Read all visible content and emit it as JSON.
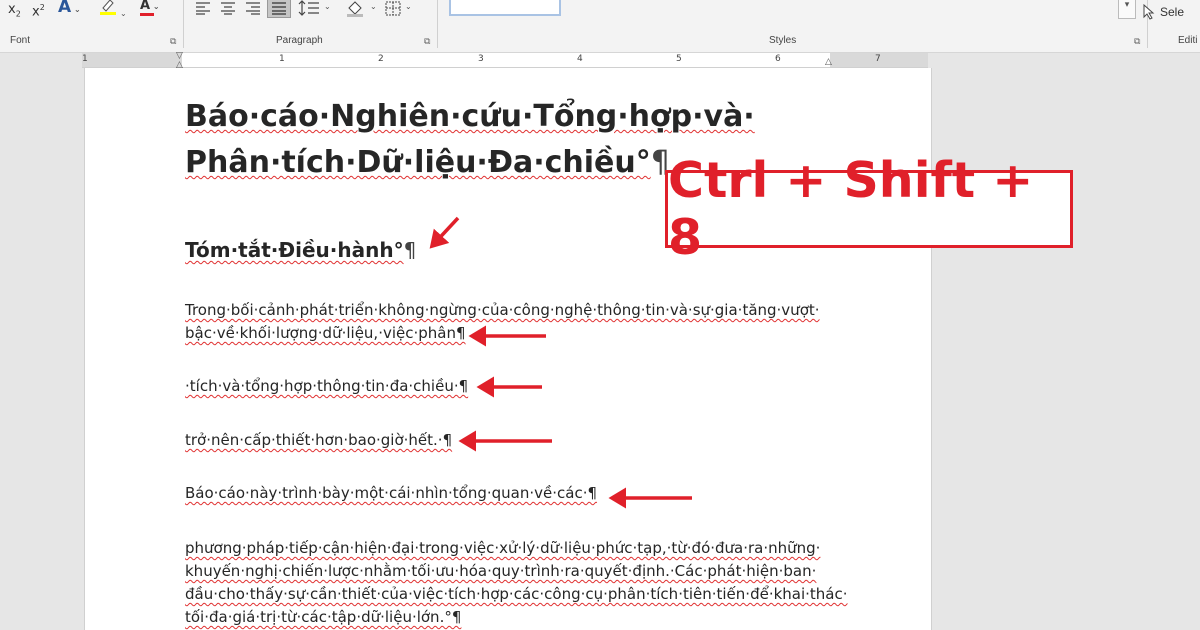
{
  "ribbon": {
    "font_group_label": "Font",
    "paragraph_group_label": "Paragraph",
    "styles_group_label": "Styles",
    "editing_group_label": "Editi",
    "select_label": "Sele",
    "subscript_label": "x",
    "subscript_sub": "2",
    "superscript_label": "x",
    "superscript_sup": "2",
    "text_effects_label": "A",
    "highlight_label": "ab",
    "font_color_label": "A",
    "icons": [
      "text-effects-icon",
      "highlight-icon",
      "font-color-icon",
      "align-left-icon",
      "align-center-icon",
      "align-right-icon",
      "justify-icon",
      "line-spacing-icon",
      "shading-icon",
      "borders-icon",
      "select-cursor-icon"
    ],
    "colors": {
      "highlight": "#ffff00",
      "font_color": "#e0202a",
      "accent": "#2b579a"
    }
  },
  "ruler": {
    "numbers": [
      "1",
      "1",
      "2",
      "3",
      "4",
      "5",
      "6",
      "7"
    ]
  },
  "document": {
    "title": "Báo·cáo·Nghiên·cứu·Tổng·hợp·và· Phân·tích·Dữ·liệu·Đa·chiều°",
    "title_mark": "¶",
    "heading": "Tóm·tắt·Điều·hành°",
    "heading_mark": "¶",
    "paragraphs": [
      "Trong·bối·cảnh·phát·triển·không·ngừng·của·công·nghệ·thông·tin·và·sự·gia·tăng·vượt· bậc·về·khối·lượng·dữ·liệu,·việc·phân¶",
      "·tích·và·tổng·hợp·thông·tin·đa·chiều·¶",
      "trở·nên·cấp·thiết·hơn·bao·giờ·hết.·¶",
      "Báo·cáo·này·trình·bày·một·cái·nhìn·tổng·quan·về·các·¶",
      "phương·pháp·tiếp·cận·hiện·đại·trong·việc·xử·lý·dữ·liệu·phức·tạp,·từ·đó·đưa·ra·những· khuyến·nghị·chiến·lược·nhằm·tối·ưu·hóa·quy·trình·ra·quyết·định.·Các·phát·hiện·ban· đầu·cho·thấy·sự·cần·thiết·của·việc·tích·hợp·các·công·cụ·phân·tích·tiên·tiến·để·khai·thác· tối·đa·giá·trị·từ·các·tập·dữ·liệu·lớn.°¶"
    ]
  },
  "annotation": {
    "shortcut": "Ctrl + Shift + 8",
    "color": "#e0202a"
  }
}
